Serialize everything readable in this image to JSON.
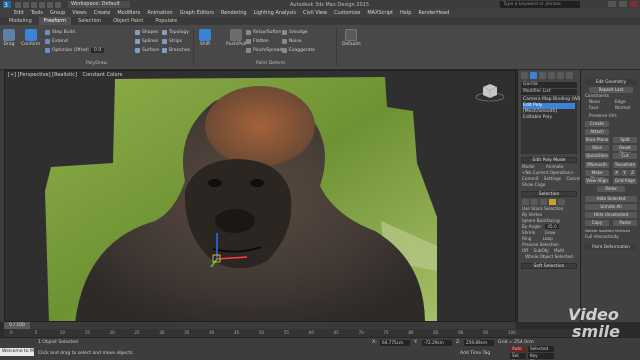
{
  "titlebar": {
    "workspace": "Workspace: Default",
    "title": "Autodesk 3ds Max Design 2015",
    "search_placeholder": "Type a keyword or phrase"
  },
  "menu": [
    "Edit",
    "Tools",
    "Group",
    "Views",
    "Create",
    "Modifiers",
    "Animation",
    "Graph Editors",
    "Rendering",
    "Lighting Analysis",
    "Civil View",
    "Customize",
    "MAXScript",
    "Help",
    "RenderHead"
  ],
  "ribbon_tabs": [
    "Modeling",
    "Freeform",
    "Selection",
    "Object Paint",
    "Populate"
  ],
  "ribbon_active_tab": "Freeform",
  "ribbon": {
    "left_buttons": [
      "Drag",
      "Conform"
    ],
    "step_items": [
      "Step Build",
      "Extend",
      "Optimize"
    ],
    "offset_label": "Offset:",
    "offset_value": "0.0",
    "shape_items": [
      "Shapes",
      "Splines",
      "Surface"
    ],
    "topology_items": [
      "Topology",
      "Strips",
      "Branches"
    ],
    "polydraw_group": "PolyDraw",
    "paint_buttons": [
      "Shift",
      "Push/Pull"
    ],
    "paint_items_a": [
      "Relax/Soften",
      "Flatten",
      "Pinch/Spread"
    ],
    "paint_items_b": [
      "Smudge",
      "Noise",
      "Exaggerate"
    ],
    "paint_group": "Paint Deform",
    "defaults_label": "Defaults"
  },
  "viewport": {
    "label": "[+] [Perspective] [Realistic]",
    "tab_label": "Constant Colors"
  },
  "command_panel": {
    "object_name": "Gorilla",
    "modifier_list": "Modifier List",
    "stack": [
      "Camera Map Binding (WS)",
      "Edit Poly",
      "[Mesh/Smooth]",
      "Editable Poly"
    ],
    "edit_poly_mode": "Edit Poly Mode",
    "model_label": "Model",
    "animate_label": "Animate",
    "no_current_op": "<No Current Operation>",
    "commit": "Commit",
    "settings": "Settings",
    "cancel": "Cancel",
    "show_cage": "Show Cage",
    "selection": "Selection",
    "use_stack_selection": "Use Stack Selection",
    "by_vertex": "By Vertex",
    "ignore_backfacing": "Ignore Backfacing",
    "by_angle": "By Angle:",
    "by_angle_value": "45.0",
    "shrink": "Shrink",
    "grow": "Grow",
    "ring": "Ring",
    "loop": "Loop",
    "preview_selection": "Preview Selection",
    "off": "Off",
    "subobj": "SubObj",
    "multi": "Multi",
    "whole_object_selected": "Whole Object Selected",
    "soft_selection": "Soft Selection"
  },
  "right_panel": {
    "edit_geometry": "Edit Geometry",
    "repeat_last": "Repeat Last",
    "constraints": "Constraints",
    "none": "None",
    "edge": "Edge",
    "face": "Face",
    "normal": "Normal",
    "preserve_uvs": "Preserve UVs",
    "create": "Create",
    "attach": "Attach",
    "slice_plane": "Slice Plane",
    "split": "Split",
    "slice": "Slice",
    "reset_plane": "Reset Plane",
    "quickslice": "QuickSlice",
    "cut": "Cut",
    "msmooth": "MSmooth",
    "tessellate": "Tessellate",
    "make_planar": "Make Planar",
    "x": "X",
    "y": "Y",
    "z": "Z",
    "view_align": "View Align",
    "grid_align": "Grid Align",
    "relax": "Relax",
    "hide_selected": "Hide Selected",
    "unhide_all": "Unhide All",
    "hide_unselected": "Hide Unselected",
    "copy": "Copy",
    "paste": "Paste",
    "delete_isolated": "Delete Isolated Vertices",
    "full_interactivity": "Full Interactivity",
    "paint_deformation": "Paint Deformation"
  },
  "timeline": {
    "frame": "0 / 100",
    "ticks": [
      "0",
      "5",
      "10",
      "15",
      "20",
      "25",
      "30",
      "35",
      "40",
      "45",
      "50",
      "55",
      "60",
      "65",
      "70",
      "75",
      "80",
      "85",
      "90",
      "95",
      "100"
    ]
  },
  "status": {
    "maxscript": "Welcome to M",
    "selected": "1 Object Selected",
    "prompt": "Click and drag to select and move objects",
    "x_label": "X:",
    "x_value": "64.775cm",
    "y_label": "Y:",
    "y_value": "-72.29cm",
    "z_label": "Z:",
    "z_value": "259.89cm",
    "grid": "Grid = 254.0cm",
    "auto_key": "Auto Key",
    "set_key": "Set Key",
    "selected_dropdown": "Selected",
    "key_filters": "Key Filters...",
    "add_time_tag": "Add Time Tag"
  },
  "watermark": {
    "line1": "Video",
    "line2": "smile"
  },
  "colors": {
    "accent_blue": "#3c82d6",
    "ui_dark": "#2b2b2b",
    "ui_mid": "#454545",
    "autokey_red": "#9a2b2b"
  }
}
